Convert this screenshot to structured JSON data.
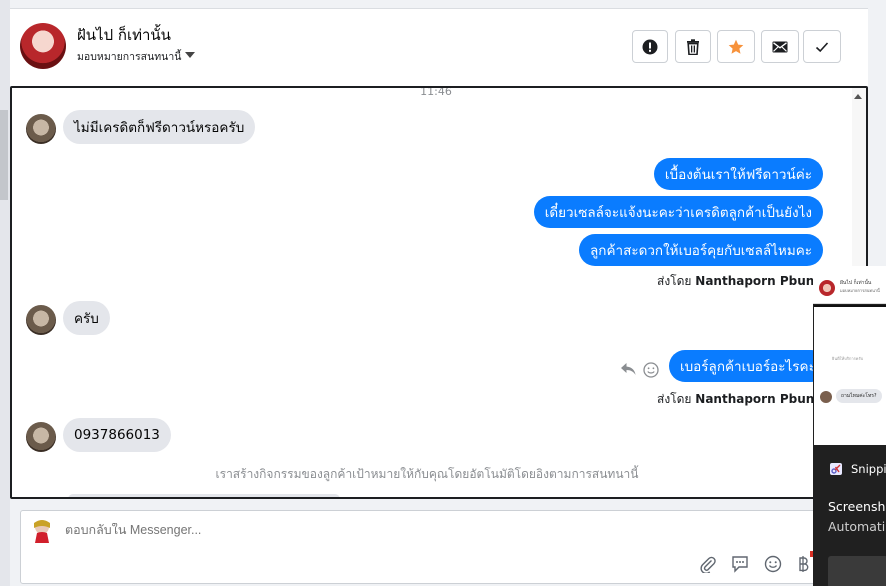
{
  "header": {
    "name": "ฝันไป ก็เท่านั้น",
    "assign_label": "มอบหมายการสนทนานี้"
  },
  "toolbar": [
    {
      "name": "spam-button",
      "icon": "alert-icon"
    },
    {
      "name": "delete-button",
      "icon": "trash-icon"
    },
    {
      "name": "star-button",
      "icon": "star-icon"
    },
    {
      "name": "mark-unread-button",
      "icon": "envelope-icon"
    },
    {
      "name": "done-button",
      "icon": "check-icon"
    }
  ],
  "colors": {
    "outgoing_bubble": "#0a7cff",
    "incoming_bubble": "#e4e6eb",
    "star": "#f7923b"
  },
  "conversation": {
    "time": "11:46",
    "messages": {
      "m1": "ไม่มีเครดิตก็ฟรีดาวน์หรอครับ",
      "m2": "เบื้องต้นเราให้ฟรีดาวน์ค่ะ",
      "m3": "เดี๋ยวเซลล์จะแจ้งนะคะว่าเครดิตลูกค้าเป็นยังไง",
      "m4": "ลูกค้าสะดวกให้เบอร์คุยกับเซลล์ไหมคะ",
      "m5": "ครับ",
      "m6": "เบอร์ลูกค้าเบอร์อะไรคะ",
      "m7": "0937866013"
    },
    "sent_by_prefix": "ส่งโดย",
    "sent_by_name": "Nanthaporn Pbunny",
    "system_message": "เราสร้างกิจกรรมของลูกค้าเป้าหมายให้กับคุณโดยอัตโนมัติโดยอิงตามการสนทนานี้"
  },
  "composer": {
    "placeholder": "ตอบกลับใน Messenger..."
  },
  "overlay": {
    "mini_name": "ฝันไป ก็เท่านั้น",
    "mini_sub": "มอบหมายการสนทนานี้",
    "mini_preview": "ยินดีให้บริการครับ",
    "mini_bubble": "ถามไหมค่ะโทร?",
    "app_name": "Snippi",
    "title": "Screensho",
    "subtitle": "Automati"
  }
}
